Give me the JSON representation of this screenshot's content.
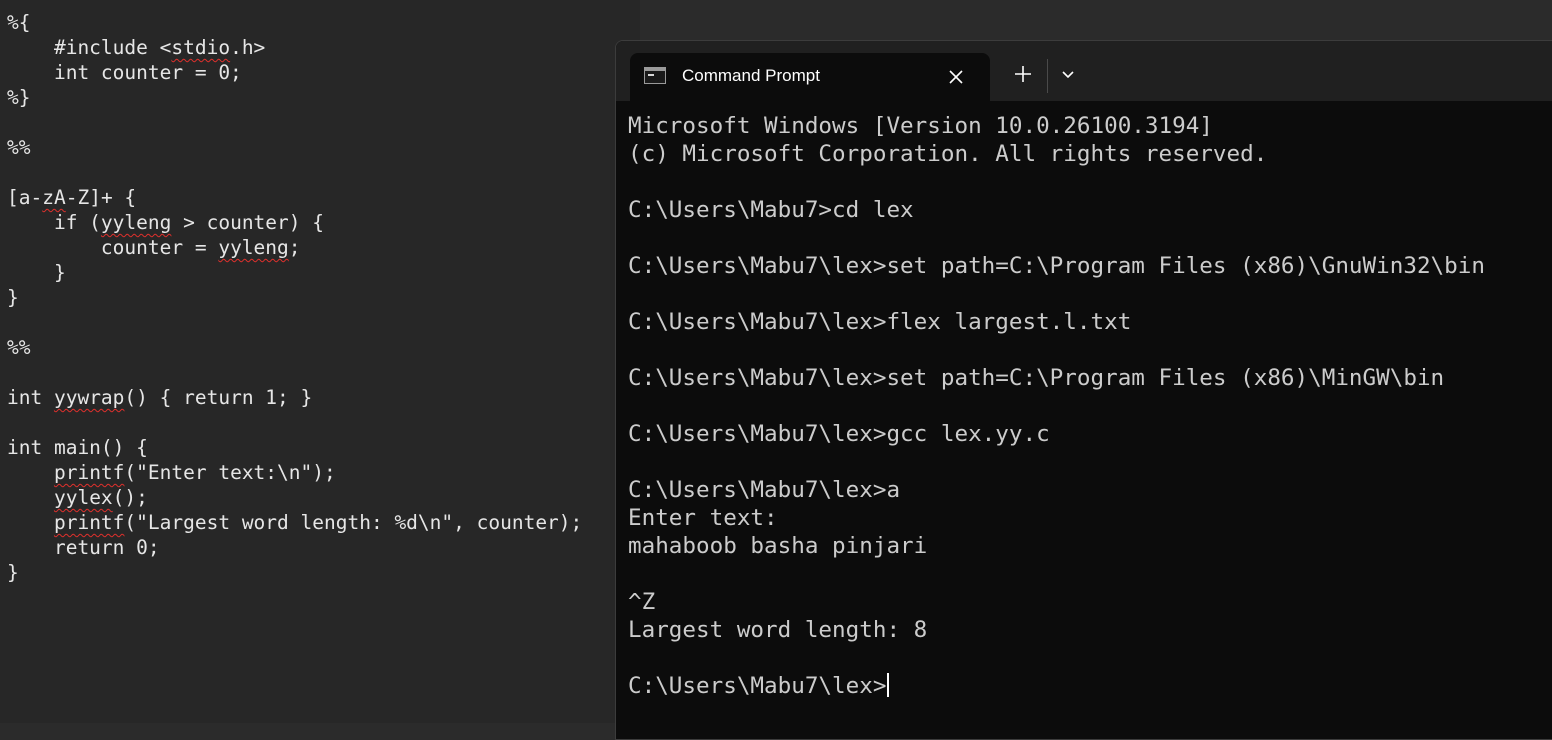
{
  "editor": {
    "lines": [
      {
        "segments": [
          {
            "text": "%{"
          }
        ]
      },
      {
        "segments": [
          {
            "text": "    #include <"
          },
          {
            "text": "stdio",
            "squiggle": true
          },
          {
            "text": ".h>"
          }
        ]
      },
      {
        "segments": [
          {
            "text": "    int counter = 0;"
          }
        ]
      },
      {
        "segments": [
          {
            "text": "%}"
          }
        ]
      },
      {
        "segments": [
          {
            "text": ""
          }
        ]
      },
      {
        "segments": [
          {
            "text": "%%"
          }
        ]
      },
      {
        "segments": [
          {
            "text": ""
          }
        ]
      },
      {
        "segments": [
          {
            "text": "[a-"
          },
          {
            "text": "zA",
            "squiggle": true
          },
          {
            "text": "-Z]+ {"
          }
        ]
      },
      {
        "segments": [
          {
            "text": "    if ("
          },
          {
            "text": "yyleng",
            "squiggle": true
          },
          {
            "text": " > counter) {"
          }
        ]
      },
      {
        "segments": [
          {
            "text": "        counter = "
          },
          {
            "text": "yyleng",
            "squiggle": true
          },
          {
            "text": ";"
          }
        ]
      },
      {
        "segments": [
          {
            "text": "    }"
          }
        ]
      },
      {
        "segments": [
          {
            "text": "}"
          }
        ]
      },
      {
        "segments": [
          {
            "text": ""
          }
        ]
      },
      {
        "segments": [
          {
            "text": "%%"
          }
        ]
      },
      {
        "segments": [
          {
            "text": ""
          }
        ]
      },
      {
        "segments": [
          {
            "text": "int "
          },
          {
            "text": "yywrap",
            "squiggle": true
          },
          {
            "text": "() { return 1; }"
          }
        ]
      },
      {
        "segments": [
          {
            "text": ""
          }
        ]
      },
      {
        "segments": [
          {
            "text": "int main() {"
          }
        ]
      },
      {
        "segments": [
          {
            "text": "    "
          },
          {
            "text": "printf",
            "squiggle": true
          },
          {
            "text": "(\"Enter text:\\n\");"
          }
        ]
      },
      {
        "segments": [
          {
            "text": "    "
          },
          {
            "text": "yylex",
            "squiggle": true
          },
          {
            "text": "();"
          }
        ]
      },
      {
        "segments": [
          {
            "text": "    "
          },
          {
            "text": "printf",
            "squiggle": true
          },
          {
            "text": "(\"Largest word length: %d\\n\", counter);"
          }
        ]
      },
      {
        "segments": [
          {
            "text": "    return 0;"
          }
        ]
      },
      {
        "segments": [
          {
            "text": "}"
          }
        ]
      }
    ]
  },
  "terminal": {
    "tab_title": "Command Prompt",
    "tab_icon": "terminal-icon",
    "close_icon": "close-icon",
    "new_tab_icon": "plus-icon",
    "dropdown_icon": "chevron-down-icon",
    "output_lines": [
      "Microsoft Windows [Version 10.0.26100.3194]",
      "(c) Microsoft Corporation. All rights reserved.",
      "",
      "C:\\Users\\Mabu7>cd lex",
      "",
      "C:\\Users\\Mabu7\\lex>set path=C:\\Program Files (x86)\\GnuWin32\\bin",
      "",
      "C:\\Users\\Mabu7\\lex>flex largest.l.txt",
      "",
      "C:\\Users\\Mabu7\\lex>set path=C:\\Program Files (x86)\\MinGW\\bin",
      "",
      "C:\\Users\\Mabu7\\lex>gcc lex.yy.c",
      "",
      "C:\\Users\\Mabu7\\lex>a",
      "Enter text:",
      "mahaboob basha pinjari",
      "",
      "^Z",
      "Largest word length: 8",
      ""
    ],
    "prompt": "C:\\Users\\Mabu7\\lex>"
  },
  "colors": {
    "editor_bg": "#272727",
    "editor_text": "#e6e6e6",
    "squiggle": "#e0302c",
    "terminal_bg": "#0c0c0c",
    "terminal_text": "#cccccc",
    "titlebar_bg": "#202020"
  }
}
